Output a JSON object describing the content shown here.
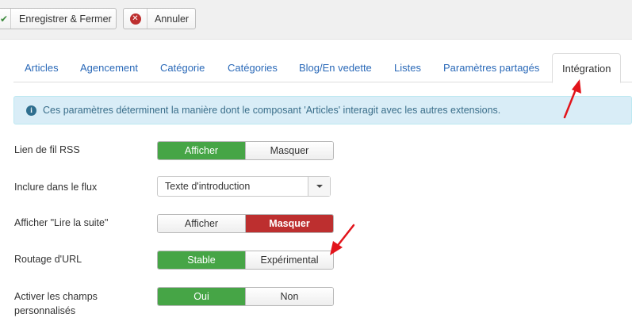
{
  "toolbar": {
    "save_close": {
      "label": "Enregistrer & Fermer",
      "icon": "check-icon"
    },
    "cancel": {
      "label": "Annuler",
      "icon": "cancel-circle-icon"
    }
  },
  "tabs": [
    {
      "label": "Articles",
      "active": false
    },
    {
      "label": "Agencement",
      "active": false
    },
    {
      "label": "Catégorie",
      "active": false
    },
    {
      "label": "Catégories",
      "active": false
    },
    {
      "label": "Blog/En vedette",
      "active": false
    },
    {
      "label": "Listes",
      "active": false
    },
    {
      "label": "Paramètres partagés",
      "active": false
    },
    {
      "label": "Intégration",
      "active": true
    }
  ],
  "alert": {
    "icon": "info-icon",
    "text": "Ces paramètres déterminent la manière dont le composant 'Articles' interagit avec les autres extensions."
  },
  "fields": {
    "rss_link": {
      "label": "Lien de fil RSS",
      "options": [
        "Afficher",
        "Masquer"
      ],
      "selected": "Afficher"
    },
    "include_in_feed": {
      "label": "Inclure dans le flux",
      "value": "Texte d'introduction"
    },
    "read_more": {
      "label": "Afficher \"Lire la suite\"",
      "options": [
        "Afficher",
        "Masquer"
      ],
      "selected": "Masquer"
    },
    "url_routing": {
      "label": "Routage d'URL",
      "options": [
        "Stable",
        "Expérimental"
      ],
      "selected": "Stable"
    },
    "custom_fields": {
      "label_line1": "Activer les champs",
      "label_line2": "personnalisés",
      "options": [
        "Oui",
        "Non"
      ],
      "selected": "Oui"
    }
  },
  "colors": {
    "accent_green": "#46a546",
    "accent_red": "#bd2f2f",
    "link_blue": "#2a69b8",
    "annotation_arrow": "#e2141b"
  }
}
